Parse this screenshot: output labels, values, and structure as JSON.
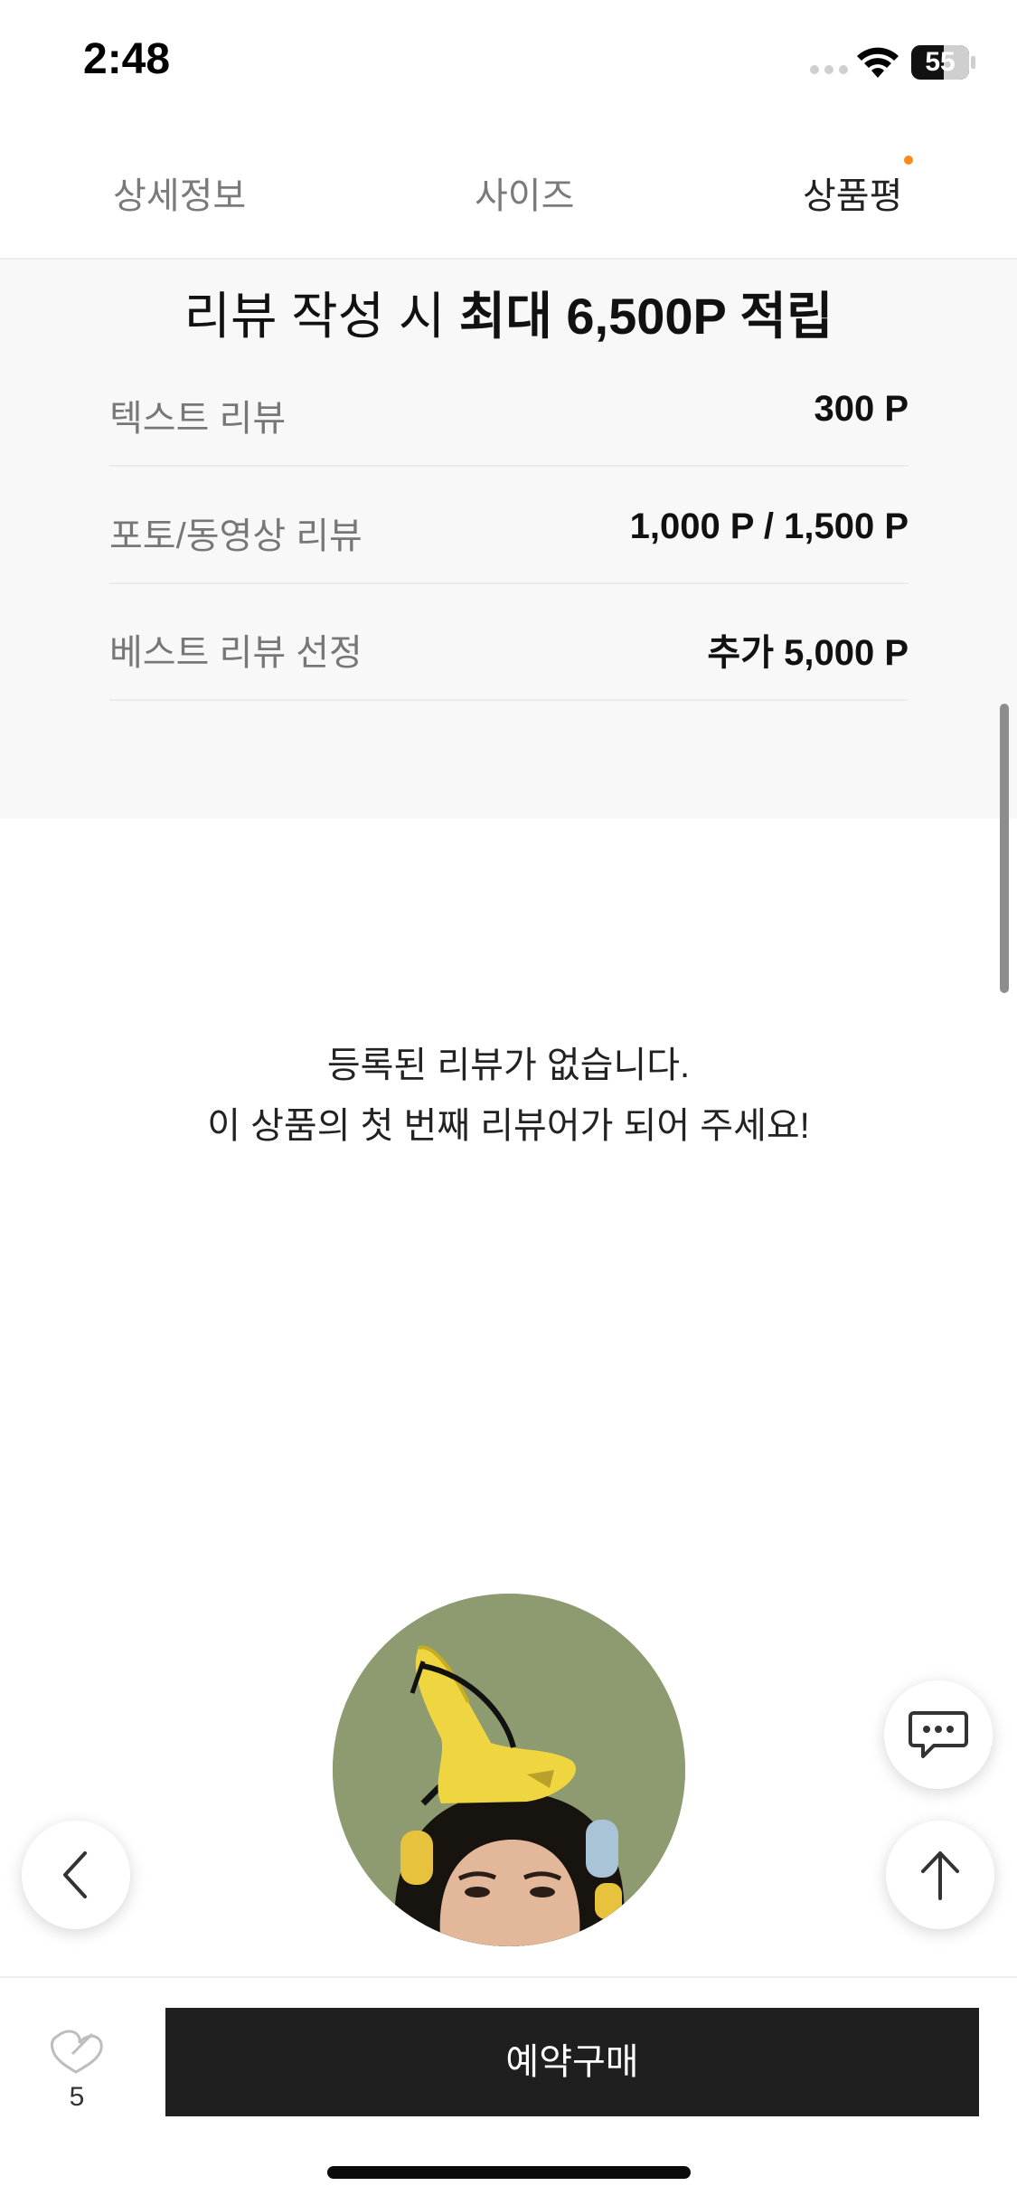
{
  "status_bar": {
    "time": "2:48",
    "battery": "55"
  },
  "tabs": [
    {
      "label": "상세정보",
      "active": false
    },
    {
      "label": "사이즈",
      "active": false
    },
    {
      "label": "상품평",
      "active": true,
      "has_dot": true
    }
  ],
  "reward": {
    "title_prefix": "리뷰 작성 시",
    "title_emphasis": "최대 6,500P 적립",
    "rows": [
      {
        "label": "텍스트 리뷰",
        "value": "300 P"
      },
      {
        "label": "포토/동영상 리뷰",
        "value": "1,000 P / 1,500 P"
      },
      {
        "label": "베스트 리뷰 선정",
        "value": "추가 5,000 P"
      }
    ]
  },
  "empty_state": {
    "line1": "등록된 리뷰가 없습니다.",
    "line2": "이 상품의 첫 번째 리뷰어가 되어 주세요!"
  },
  "floating": {
    "chat_icon": "chat-bubble-icon",
    "back_icon": "chevron-left-icon",
    "top_icon": "arrow-up-icon"
  },
  "bottom_bar": {
    "like_count": "5",
    "buy_label": "예약구매"
  },
  "colors": {
    "accent_dot": "#ff8a1c",
    "buy_button": "#1f1f1f",
    "section_bg": "#f8f8f8"
  }
}
